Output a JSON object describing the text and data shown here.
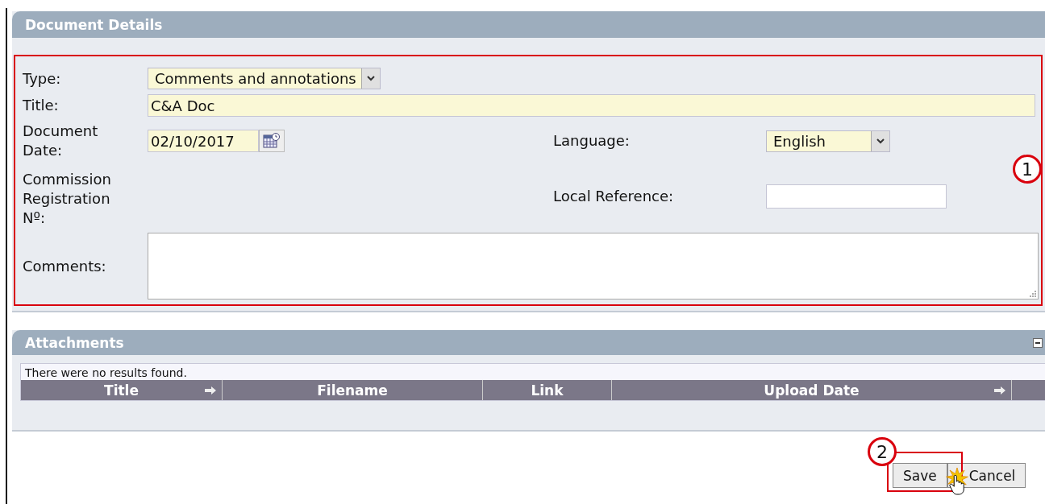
{
  "document_details": {
    "title": "Document Details",
    "type": {
      "label": "Type:",
      "value": "Comments and annotations"
    },
    "title_field": {
      "label": "Title:",
      "value": "C&A Doc"
    },
    "document_date": {
      "label": "Document Date:",
      "value": "02/10/2017"
    },
    "language": {
      "label": "Language:",
      "value": "English"
    },
    "commission_registration": {
      "label": "Commission Registration Nº:"
    },
    "local_reference": {
      "label": "Local Reference:"
    },
    "comments": {
      "label": "Comments:"
    }
  },
  "attachments": {
    "title": "Attachments",
    "message": "There were no results found.",
    "columns": [
      {
        "label": "Title",
        "sortable": true
      },
      {
        "label": "Filename",
        "sortable": false
      },
      {
        "label": "Link",
        "sortable": false
      },
      {
        "label": "Upload Date",
        "sortable": true
      }
    ]
  },
  "buttons": [
    "Save",
    "Cancel"
  ],
  "callouts": [
    "1",
    "2"
  ]
}
